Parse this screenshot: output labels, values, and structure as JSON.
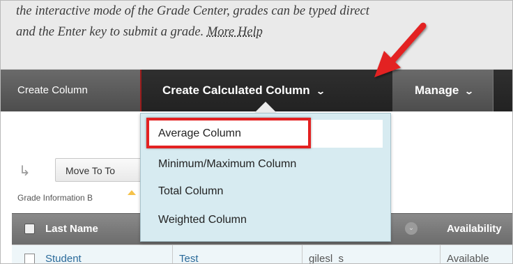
{
  "instructions": {
    "line1": "the interactive mode of the Grade Center, grades can be typed direct",
    "line2_prefix": "and the Enter key to submit a grade. ",
    "more_help": "More Help"
  },
  "actionbar": {
    "create_column": "Create Column",
    "create_calculated_column": "Create Calculated Column",
    "manage": "Manage",
    "chevron": "chevron-down-icon"
  },
  "dropdown": {
    "items": [
      "Average Column",
      "Minimum/Maximum Column",
      "Total Column",
      "Weighted Column"
    ],
    "highlighted_index": 0
  },
  "toolbar": {
    "move_to_top": "Move To To",
    "grade_information": "Grade Information B"
  },
  "table": {
    "headers": {
      "last_name": "Last Name",
      "availability": "Availability"
    },
    "rows": [
      {
        "last_name": "Student",
        "first_name": "Test",
        "username": "gilesl_s",
        "availability": "Available"
      }
    ]
  },
  "colors": {
    "callout_red": "#e32121",
    "menu_bg": "#d7ebf1",
    "actionbar_dark": "#222222"
  }
}
